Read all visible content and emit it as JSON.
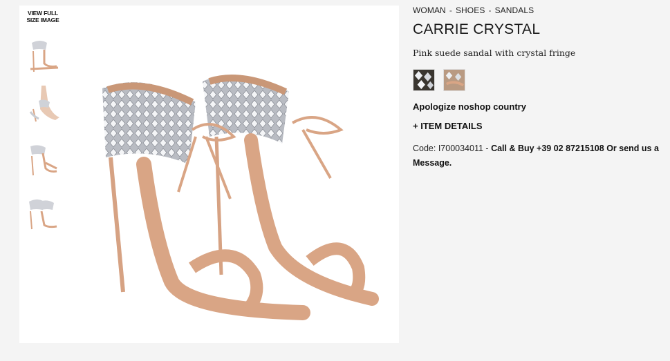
{
  "gallery": {
    "view_full_label": "VIEW FULL SIZE IMAGE",
    "thumbnails": [
      "thumbnail-1",
      "thumbnail-2",
      "thumbnail-3",
      "thumbnail-4"
    ]
  },
  "breadcrumb": {
    "items": [
      "WOMAN",
      "SHOES",
      "SANDALS"
    ],
    "separator": "-"
  },
  "product": {
    "title": "CARRIE CRYSTAL",
    "subtitle": "Pink suede sandal with crystal fringe",
    "notice": "Apologize noshop country",
    "details_label": "+ ITEM DETAILS",
    "code_label": "Code: I700034011 - ",
    "contact_text": "Call & Buy +39 02 87215108 Or send us a Message."
  },
  "colors": {
    "suede": "#d9a585",
    "crystal": "#c9ccd2",
    "background": "#f4f4f4"
  }
}
